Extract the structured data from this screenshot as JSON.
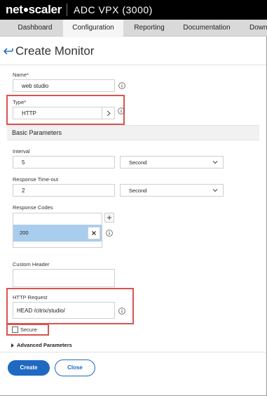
{
  "app": {
    "logo_left": "net",
    "logo_right": "scaler",
    "product": "ADC VPX (3000)"
  },
  "tabs": [
    {
      "label": "Dashboard",
      "active": false
    },
    {
      "label": "Configuration",
      "active": true
    },
    {
      "label": "Reporting",
      "active": false
    },
    {
      "label": "Documentation",
      "active": false
    },
    {
      "label": "Down",
      "active": false
    }
  ],
  "page": {
    "title": "Create Monitor",
    "back_icon": "back-arrow-icon"
  },
  "form": {
    "name_label": "Name*",
    "name_value": "web studio",
    "type_label": "Type*",
    "type_value": "HTTP",
    "basic_params_header": "Basic Parameters",
    "interval_label": "Interval",
    "interval_value": "5",
    "interval_unit": "Second",
    "timeout_label": "Response Time-out",
    "timeout_value": "2",
    "timeout_unit": "Second",
    "response_codes_label": "Response Codes",
    "response_codes": [
      "200"
    ],
    "custom_header_label": "Custom Header",
    "custom_header_value": "",
    "http_request_label": "HTTP Request",
    "http_request_value": "HEAD /citrix/studio/",
    "secure_label": "Secure",
    "secure_checked": false,
    "advanced_params_label": "Advanced Parameters"
  },
  "actions": {
    "create_label": "Create",
    "close_label": "Close"
  },
  "colors": {
    "accent": "#1f69c2",
    "highlight_box": "#d9534f",
    "chip_bg": "#a9cdef"
  }
}
